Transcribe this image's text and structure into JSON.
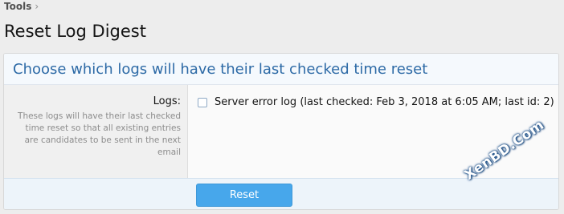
{
  "breadcrumb": {
    "items": [
      "Tools"
    ]
  },
  "page": {
    "title": "Reset Log Digest"
  },
  "block": {
    "header": "Choose which logs will have their last checked time reset"
  },
  "form": {
    "field_label": "Logs:",
    "field_hint": "These logs will have their last checked time reset so that all existing entries are candidates to be sent in the next email",
    "options": [
      {
        "label": "Server error log (last checked: Feb 3, 2018 at 6:05 AM; last id: 2)",
        "checked": false
      }
    ]
  },
  "footer": {
    "button_label": "Reset"
  },
  "watermark": {
    "text": "XenBD.Com"
  },
  "colors": {
    "accent": "#2d6aa6",
    "button": "#47a7eb"
  }
}
